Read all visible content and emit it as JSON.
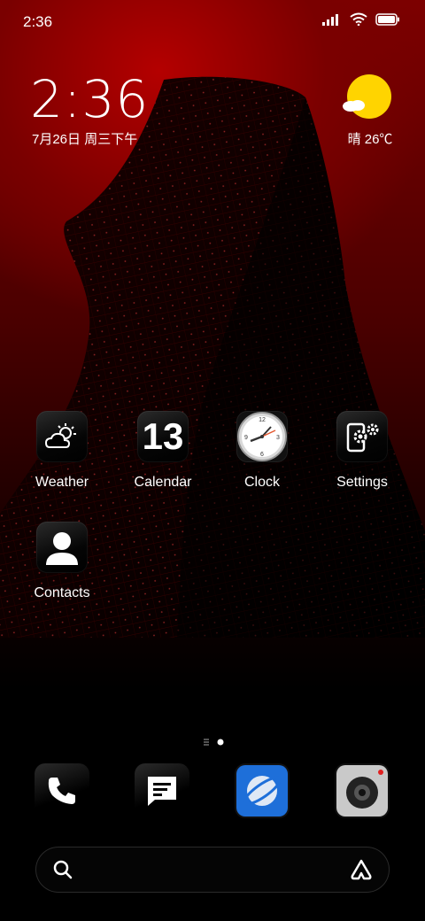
{
  "status": {
    "time": "2:36"
  },
  "widget": {
    "time": "2:36",
    "date": "7月26日 周三下午",
    "weather": "晴 26℃"
  },
  "apps": [
    {
      "label": "Weather",
      "icon": "weather-icon"
    },
    {
      "label": "Calendar",
      "icon": "calendar-icon",
      "day": "13"
    },
    {
      "label": "Clock",
      "icon": "clock-icon"
    },
    {
      "label": "Settings",
      "icon": "settings-icon"
    },
    {
      "label": "Contacts",
      "icon": "contacts-icon"
    }
  ],
  "dock": [
    "phone-icon",
    "messages-icon",
    "browser-icon",
    "camera-icon"
  ],
  "page_indicator": {
    "pages": 2,
    "current": 2
  },
  "colors": {
    "sun": "#ffd400",
    "browser": "#1e6fd9",
    "wallpaper_red": "#8a0000"
  }
}
